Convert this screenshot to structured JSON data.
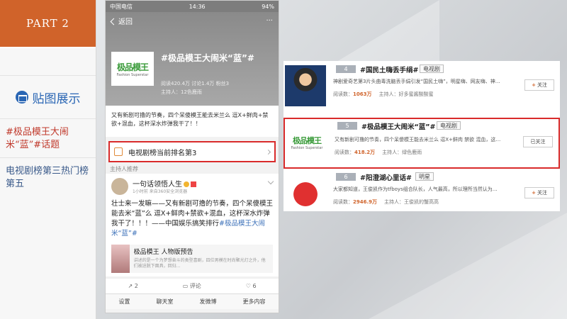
{
  "left_panel": {
    "part_label": "PART  2",
    "section_title": "贴图展示",
    "topic_text": "#极品模王大闹米“蓝”#话题",
    "rank_text": "电视剧榜第三热门榜第五"
  },
  "phone": {
    "status": {
      "carrier": "中国电信",
      "time": "14:36",
      "battery": "94%"
    },
    "back_label": "返回",
    "more_label": "···",
    "logo_main": "极品模王",
    "logo_sub": "Fashion Superstar",
    "topic_title": "#极品模王大闹米“蓝”#",
    "stats": "阅读420.4万   讨论1.4万   粉丝3",
    "host": "主持人：12色鹿雨",
    "description": "又有新剧可撸的节奏，四个呆傻模王能去米兰么 逗X+鲜肉+禁欲+混血，这杯深水炸弹我干了！！",
    "rank_label": "电视剧榜当前排名第3",
    "recommend_label": "主持人推荐",
    "post": {
      "user": "一句话领悟人生",
      "time": "1小时前  来自360安全浏览器",
      "text": "壮士来一发嘛——又有新剧可撸的节奏，四个呆傻模王能去米“蓝”么 逗X+鲜肉+禁欲+混血，这杯深水炸弹我干了！！！——中国娱乐搞笑排行",
      "text_tag": "#极品模王大闹米“蓝”#",
      "card_title": "极品模王 人物版预告",
      "card_sub": "讲述的是一个为梦想奋斗的类型喜剧，四位男模在时尚聚光灯之外，他们被迫脱下面具，回归…",
      "repost_count": "2",
      "comment_label": "评论",
      "like_count": "6"
    },
    "tabs": [
      "设置",
      "聊天室",
      "发微博",
      "更多内容"
    ]
  },
  "ranking_list": [
    {
      "rank": "4",
      "title": "#国民土嗨丢手绢#",
      "tag": "电视剧",
      "desc": "神剧爱奇艺第3片头曲毒洗脑丢手绢引发“国民土嗨”，明星嗨、网友嗨、神…",
      "reads_label": "阅读数：",
      "reads": "1063万",
      "host": "主持人：好多蜜酱酸酸蜜",
      "action": "关注"
    },
    {
      "rank": "5",
      "title": "#极品模王大闹米“蓝”#",
      "tag": "电视剧",
      "desc": "又有新剧可撸的节奏，四个呆傻模王能去米兰么 逗X+鲜肉 禁欲 混血，这…",
      "reads_label": "阅读数：",
      "reads": "418.2万",
      "host": "主持人：绿色鹿雨",
      "action": "已关注"
    },
    {
      "rank": "6",
      "title": "#阳澄湖心里话#",
      "tag": "明星",
      "desc": "大家都知道，王俊凯作为tfboys组合队长，人气最高，所以理所当然认为…",
      "reads_label": "阅读数：",
      "reads": "2946.9万",
      "host": "主持人：王俊凯的蟹高高",
      "action": "关注"
    }
  ]
}
